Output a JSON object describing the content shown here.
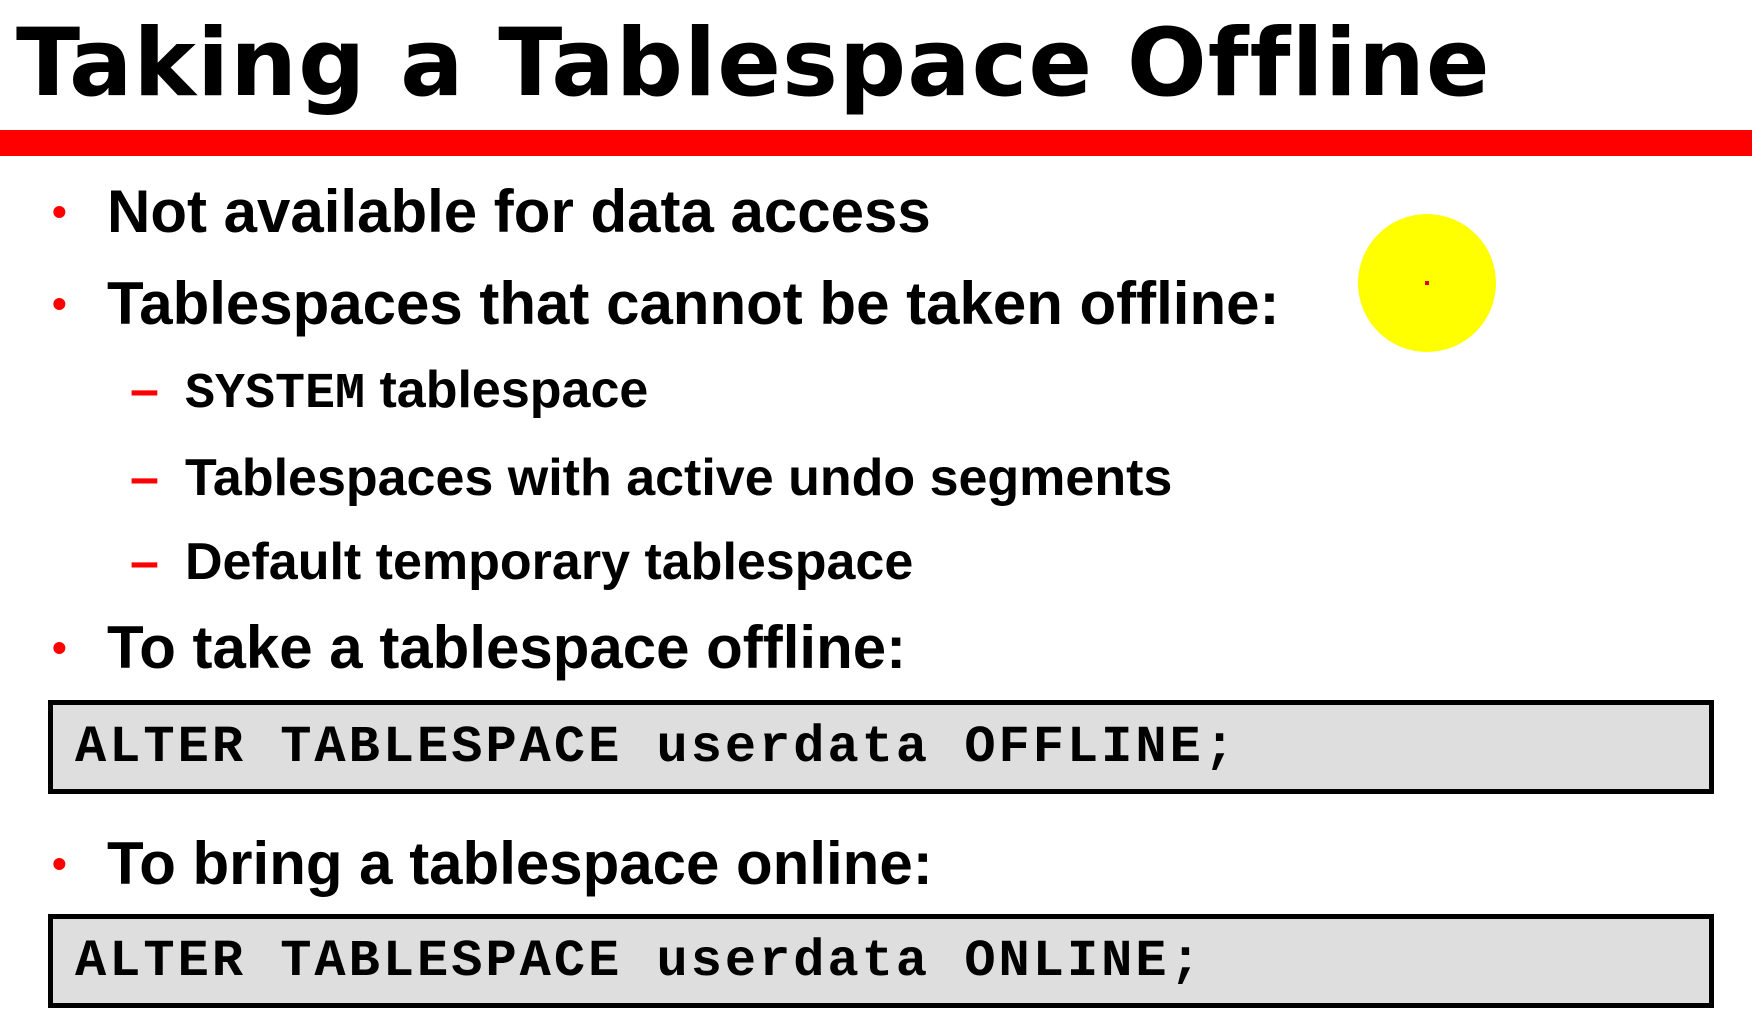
{
  "slide": {
    "title": "Taking a Tablespace Offline",
    "accent_color": "#ff0000",
    "bullet_symbol": "•",
    "dash_symbol": "–"
  },
  "bullets": [
    {
      "text": "Not available for data access"
    },
    {
      "text": "Tablespaces that cannot be taken offline:"
    },
    {
      "text": "To take a tablespace offline:"
    },
    {
      "text": "To bring a tablespace online:"
    }
  ],
  "sub_bullets": [
    {
      "code": "SYSTEM",
      "text": " tablespace"
    },
    {
      "text": "Tablespaces with active undo segments"
    },
    {
      "text": "Default temporary tablespace"
    }
  ],
  "code_blocks": [
    {
      "code": "ALTER TABLESPACE userdata OFFLINE;"
    },
    {
      "code": "ALTER TABLESPACE userdata ONLINE;"
    }
  ],
  "pointer": {
    "color": "#ffff00",
    "icon": "laser-pointer-icon"
  }
}
